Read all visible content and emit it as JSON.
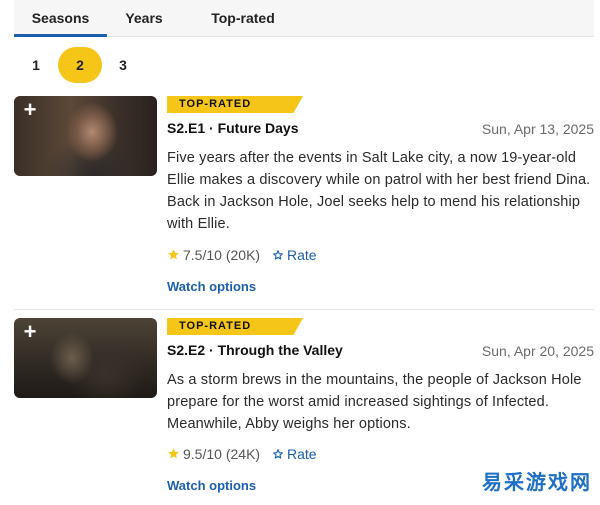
{
  "tabs": {
    "seasons": "Seasons",
    "years": "Years",
    "top_rated": "Top-rated",
    "active": "Seasons"
  },
  "pagination": {
    "pages": [
      "1",
      "2",
      "3"
    ],
    "current": "2"
  },
  "episodes": [
    {
      "badge": "TOP-RATED",
      "title": "S2.E1 · Future Days",
      "date": "Sun, Apr 13, 2025",
      "description": "Five years after the events in Salt Lake city, a now 19-year-old Ellie makes a discovery while on patrol with her best friend Dina. Back in Jackson Hole, Joel seeks help to mend his relationship with Ellie.",
      "rating": "7.5",
      "rating_scale": "/10",
      "votes": "(20K)",
      "rate_label": "Rate",
      "watch_label": "Watch options"
    },
    {
      "badge": "TOP-RATED",
      "title": "S2.E2 · Through the Valley",
      "date": "Sun, Apr 20, 2025",
      "description": "As a storm brews in the mountains, the people of Jackson Hole prepare for the worst amid increased sightings of Infected. Meanwhile, Abby weighs her options.",
      "rating": "9.5",
      "rating_scale": "/10",
      "votes": "(24K)",
      "rate_label": "Rate",
      "watch_label": "Watch options"
    }
  ],
  "watermark": "易采游戏网",
  "colors": {
    "accent_yellow": "#f5c518",
    "link_blue": "#1b5fae",
    "watermark_blue": "#1e6fc7"
  },
  "icons": {
    "add": "plus-icon",
    "star": "star-icon",
    "rate": "outline-star-icon"
  }
}
